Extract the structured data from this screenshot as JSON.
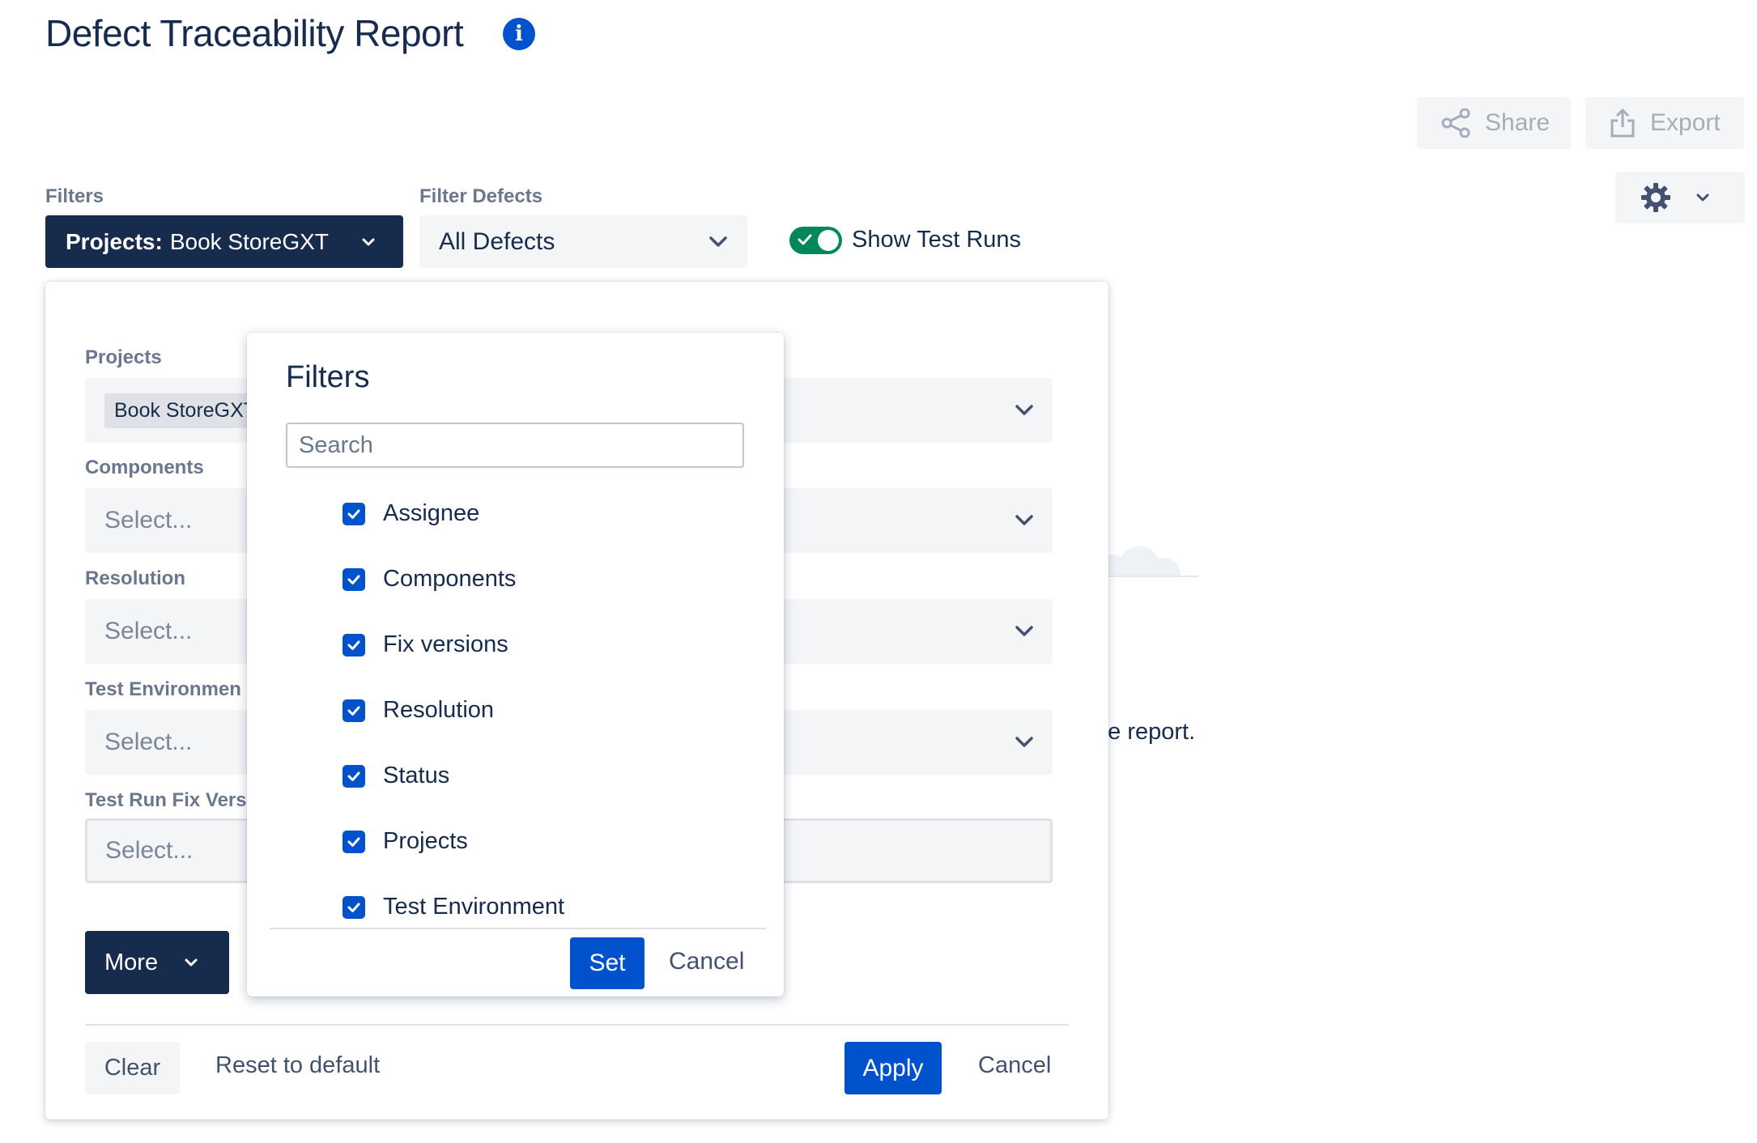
{
  "header": {
    "title": "Defect Traceability Report",
    "info_glyph": "i"
  },
  "toolbar": {
    "share_label": "Share",
    "export_label": "Export"
  },
  "filter_bar": {
    "filters_label": "Filters",
    "projects_key": "Projects:",
    "projects_value": "Book StoreGXT",
    "filter_defects_label": "Filter Defects",
    "filter_defects_value": "All Defects",
    "show_test_runs_label": "Show Test Runs",
    "show_test_runs_on": true
  },
  "background": {
    "report_text_fragment": "ne report."
  },
  "panel": {
    "fields": [
      {
        "label": "Projects",
        "tag": "Book StoreGXT"
      },
      {
        "label": "Components",
        "placeholder": "Select..."
      },
      {
        "label": "Resolution",
        "placeholder": "Select..."
      },
      {
        "label": "Test Environmen",
        "placeholder": "Select..."
      },
      {
        "label": "Test Run Fix Vers",
        "placeholder": "Select..."
      }
    ],
    "more_label": "More",
    "clear_label": "Clear",
    "reset_label": "Reset to default",
    "apply_label": "Apply",
    "cancel_label": "Cancel"
  },
  "popover": {
    "title": "Filters",
    "search_placeholder": "Search",
    "options": [
      {
        "label": "Assignee",
        "checked": true
      },
      {
        "label": "Components",
        "checked": true
      },
      {
        "label": "Fix versions",
        "checked": true
      },
      {
        "label": "Resolution",
        "checked": true
      },
      {
        "label": "Status",
        "checked": true
      },
      {
        "label": "Projects",
        "checked": true
      },
      {
        "label": "Test Environment",
        "checked": true
      }
    ],
    "set_label": "Set",
    "cancel_label": "Cancel"
  },
  "icons": {
    "info": "info-icon",
    "share": "share-icon",
    "export": "export-icon",
    "settings": "gear-icon",
    "chevron": "chevron-down-icon",
    "checkbox": "checkbox-checked-icon"
  },
  "colors": {
    "primary": "#0052cc",
    "dark_navy": "#172b4d",
    "toggle_on": "#00875a",
    "subtle_bg": "#f4f5f7",
    "label_gray": "#6b778c"
  }
}
